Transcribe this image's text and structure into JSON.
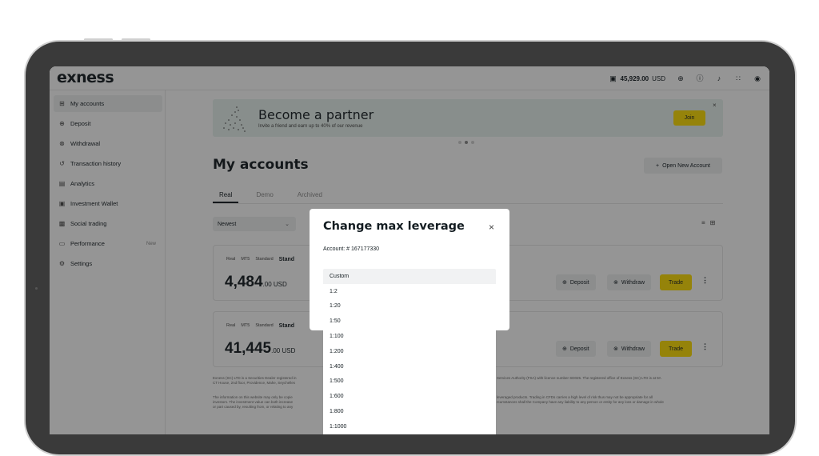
{
  "app": {
    "logo": "exness"
  },
  "topbar": {
    "balance_value": "45,929.00",
    "balance_currency": "USD",
    "icons": [
      "wallet-icon",
      "globe-icon",
      "help-icon",
      "bell-icon",
      "apps-grid-icon",
      "profile-icon"
    ]
  },
  "sidebar": {
    "items": [
      {
        "label": "My accounts",
        "icon": "accounts-grid-icon"
      },
      {
        "label": "Deposit",
        "icon": "deposit-icon"
      },
      {
        "label": "Withdrawal",
        "icon": "withdrawal-icon"
      },
      {
        "label": "Transaction history",
        "icon": "history-icon"
      },
      {
        "label": "Analytics",
        "icon": "analytics-icon"
      },
      {
        "label": "Investment Wallet",
        "icon": "wallet-icon"
      },
      {
        "label": "Social trading",
        "icon": "social-icon"
      },
      {
        "label": "Performance",
        "icon": "chart-icon",
        "badge": "New"
      },
      {
        "label": "Settings",
        "icon": "settings-icon"
      }
    ]
  },
  "banner": {
    "title": "Become a partner",
    "subtitle": "Invite a friend and earn up to 40% of our revenue",
    "join_label": "Join"
  },
  "main": {
    "title": "My accounts",
    "open_account_label": "Open New Account",
    "tabs": [
      "Real",
      "Demo",
      "Archived"
    ],
    "sort_label": "Newest"
  },
  "accounts": [
    {
      "tags": [
        "Real",
        "MT5",
        "Standard"
      ],
      "name": "Stand",
      "balance_int": "4,484",
      "balance_dec": ".00 USD",
      "deposit": "Deposit",
      "withdraw": "Withdraw",
      "trade": "Trade"
    },
    {
      "tags": [
        "Real",
        "MT5",
        "Standard"
      ],
      "name": "Stand",
      "balance_int": "41,445",
      "balance_dec": ".00 USD",
      "deposit": "Deposit",
      "withdraw": "Withdraw",
      "trade": "Trade"
    }
  ],
  "legal": {
    "line1_left": "Exness (SC) LTD is a Securities Dealer registered in",
    "line1_right": "Services Authority (FSA) with licence number SD025. The registered office of Exness (SC) LTD is at 9A",
    "line2_left": "CT House, 2nd floor, Providence, Mahe, Seychelles",
    "line3_left": "The information on this website may only be copie",
    "line3_right": "leveraged products. Trading in CFDs carries a high level of risk thus may not be appropriate for all",
    "line4_left": "investors. The investment value can both increase",
    "line4_right": "rcumstances shall the Company have any liability to any person or entity for any loss or damage in whole",
    "line5_left": "or part caused by, resulting from, or relating to any"
  },
  "modal": {
    "title": "Change max leverage",
    "account_label": "Account: # 167177330",
    "options": [
      "Custom",
      "1:2",
      "1:20",
      "1:50",
      "1:100",
      "1:200",
      "1:400",
      "1:500",
      "1:600",
      "1:800",
      "1:1000"
    ]
  }
}
